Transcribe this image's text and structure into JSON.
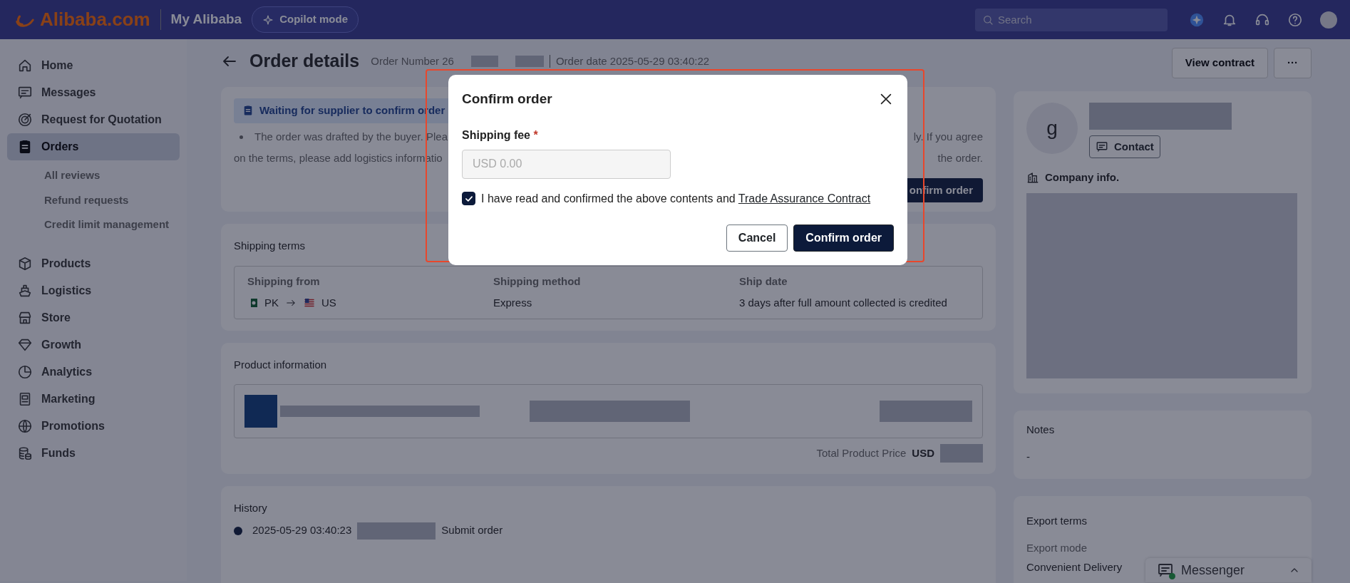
{
  "topbar": {
    "logo": "Alibaba.com",
    "section": "My Alibaba",
    "copilot_button": "Copilot mode",
    "search": {
      "placeholder": "Search"
    }
  },
  "sidebar": {
    "items": [
      {
        "label": "Home",
        "selected": false
      },
      {
        "label": "Messages",
        "selected": false
      },
      {
        "label": "Request for Quotation",
        "selected": false
      },
      {
        "label": "Orders",
        "selected": true,
        "children": [
          {
            "label": "All reviews",
            "selected": false
          },
          {
            "label": "Refund requests",
            "selected": false
          },
          {
            "label": "Credit limit management",
            "selected": false
          }
        ]
      },
      {
        "label": "Products",
        "selected": false
      },
      {
        "label": "Logistics",
        "selected": false
      },
      {
        "label": "Store",
        "selected": false
      },
      {
        "label": "Growth",
        "selected": false
      },
      {
        "label": "Analytics",
        "selected": false
      },
      {
        "label": "Marketing",
        "selected": false
      },
      {
        "label": "Promotions",
        "selected": false
      },
      {
        "label": "Funds",
        "selected": false
      }
    ]
  },
  "header": {
    "title": "Order details",
    "order_number": "Order Number 26",
    "order_date": "Order date 2025-05-29 03:40:22",
    "buttons": [
      "View contract",
      "···"
    ]
  },
  "status_card": {
    "badge": "Waiting for supplier to confirm order",
    "lines": [
      {
        "left": "The order was drafted by the buyer. Plea",
        "right": "ly. If you agree"
      },
      {
        "left": "on the terms, please add logistics informatio",
        "right": "the order."
      }
    ],
    "button": "onfirm order"
  },
  "shipping_terms": {
    "title": "Shipping terms",
    "columns": [
      {
        "label": "Shipping from",
        "kind": "route",
        "from": "PK",
        "to": "US"
      },
      {
        "label": "Shipping method",
        "kind": "text",
        "value": "Express"
      },
      {
        "label": "Ship date",
        "kind": "text",
        "value": "3 days after full amount collected is credited"
      }
    ]
  },
  "product_info": {
    "title": "Product information",
    "total_label": "Total Product Price",
    "currency": "USD"
  },
  "history": {
    "title": "History",
    "entries": [
      {
        "time": "2025-05-29 03:40:23",
        "action": "Submit order"
      }
    ]
  },
  "seller": {
    "avatar": "g",
    "contact_button": "Contact",
    "company_info": "Company info."
  },
  "notes": {
    "title": "Notes",
    "value": "-"
  },
  "export_terms": {
    "title": "Export terms",
    "label": "Export mode",
    "value": "Convenient Delivery"
  },
  "messenger": {
    "label": "Messenger"
  },
  "modal": {
    "title": "Confirm order",
    "field_label": "Shipping fee",
    "required_mark": "*",
    "placeholder": "USD 0.00",
    "agree": {
      "checked": true,
      "text": "I have read and confirmed the above contents and",
      "link": "Trade Assurance Contract"
    },
    "buttons": [
      {
        "label": "Cancel",
        "kind": "secondary"
      },
      {
        "label": "Confirm order",
        "kind": "primary"
      }
    ]
  }
}
